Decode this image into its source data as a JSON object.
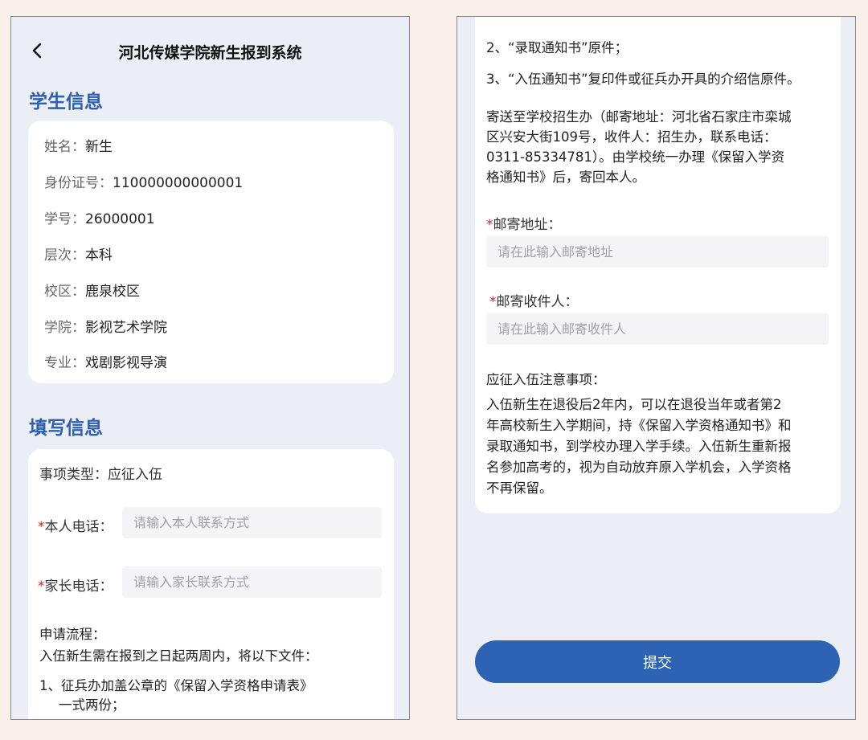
{
  "header": {
    "title": "河北传媒学院新生报到系统"
  },
  "student_info": {
    "section_title": "学生信息",
    "rows": [
      {
        "label": "姓名：",
        "value": "新生"
      },
      {
        "label": "身份证号：",
        "value": "110000000000001"
      },
      {
        "label": "学号：",
        "value": "26000001"
      },
      {
        "label": "层次：",
        "value": "本科"
      },
      {
        "label": "校区：",
        "value": "鹿泉校区"
      },
      {
        "label": "学院：",
        "value": "影视艺术学院"
      },
      {
        "label": "专业：",
        "value": "戏剧影视导演"
      }
    ]
  },
  "fill_info": {
    "section_title": "填写信息",
    "item_type_label": "事项类型：",
    "item_type_value": "应征入伍",
    "phone_label": "本人电话：",
    "phone_placeholder": "请输入本人联系方式",
    "parent_phone_label": "家长电话：",
    "parent_phone_placeholder": "请输入家长联系方式",
    "process_title": "申请流程：",
    "process_intro": "入伍新生需在报到之日起两周内，将以下文件：",
    "process_item1_line1": "1、征兵办加盖公章的《保留入学资格申请表》",
    "process_item1_line2": "一式两份；",
    "process_item2": "2、“录取通知书”原件；",
    "process_item3": "3、“入伍通知书”复印件或征兵办开具的介绍信原件。",
    "mail_line1": "寄送至学校招生办（邮寄地址：河北省石家庄市栾城",
    "mail_line2": "区兴安大街109号，收件人：招生办，联系电话：",
    "mail_line3": "0311-85334781）。由学校统一办理《保留入学资",
    "mail_line4": "格通知书》后，寄回本人。",
    "address_label": "邮寄地址：",
    "address_placeholder": "请在此输入邮寄地址",
    "recipient_label": "邮寄收件人：",
    "recipient_placeholder": "请在此输入邮寄收件人",
    "notes_title": "应征入伍注意事项：",
    "notes_line1": "入伍新生在退役后2年内，可以在退役当年或者第2",
    "notes_line2": "年高校新生入学期间，持《保留入学资格通知书》和",
    "notes_line3": "录取通知书，到学校办理入学手续。入伍新生重新报",
    "notes_line4": "名参加高考的，视为自动放弃原入学机会，入学资格",
    "notes_line5": "不再保留。",
    "required_mark": "*"
  },
  "submit_label": "提交",
  "icons": {
    "back": "chevron-left-icon"
  },
  "colors": {
    "accent": "#2d5fad",
    "button": "#2e62b2",
    "required": "#e02020",
    "background": "#faf0ea",
    "panel": "#eceef6"
  }
}
